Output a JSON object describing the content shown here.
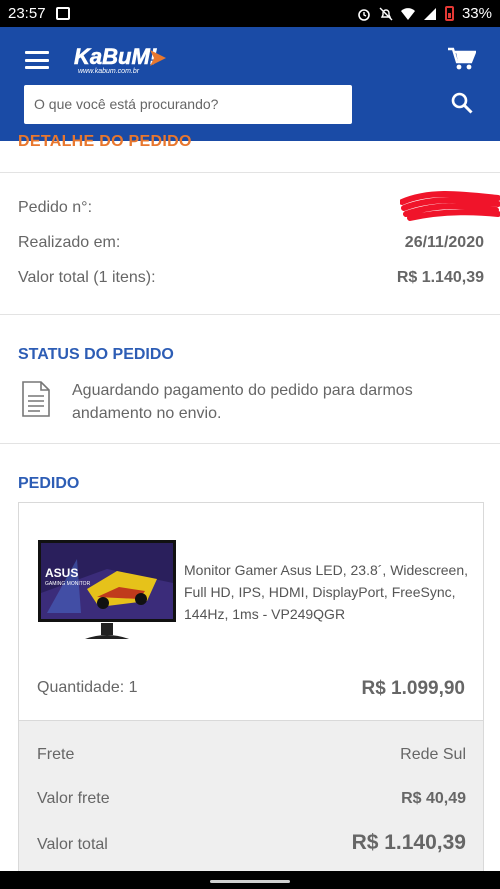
{
  "status_bar": {
    "time": "23:57",
    "battery": "33%",
    "icons": [
      "twitch-icon",
      "alarm-icon",
      "mute-icon",
      "wifi-icon",
      "signal-icon",
      "battery-icon"
    ]
  },
  "header": {
    "logo_text": "KaBuM!",
    "logo_subtext": "www.kabum.com.br",
    "search_placeholder": "O que você está procurando?",
    "colors": {
      "bar": "#1a4ba6",
      "accent_orange": "#e8772e",
      "heading_blue": "#2d5db5"
    }
  },
  "order_details": {
    "section_title": "DETALHE DO PEDIDO",
    "order_number_label": "Pedido n°:",
    "date_label": "Realizado em:",
    "date_value": "26/11/2020",
    "total_label": "Valor total (1 itens):",
    "total_value": "R$ 1.140,39"
  },
  "order_status": {
    "title": "STATUS DO PEDIDO",
    "message": "Aguardando pagamento do pedido para darmos andamento no envio."
  },
  "order": {
    "title": "PEDIDO",
    "product_name": "Monitor Gamer Asus LED, 23.8´, Widescreen, Full HD, IPS, HDMI, DisplayPort, FreeSync, 144Hz, 1ms - VP249QGR",
    "image_brand": "ASUS",
    "image_caption": "GAMING MONITOR",
    "quantity_label": "Quantidade: 1",
    "price": "R$ 1.099,90",
    "shipping_label": "Frete",
    "shipping_value": "Rede Sul",
    "shipping_cost_label": "Valor frete",
    "shipping_cost_value": "R$ 40,49",
    "grand_total_label": "Valor total",
    "grand_total_value": "R$ 1.140,39"
  }
}
